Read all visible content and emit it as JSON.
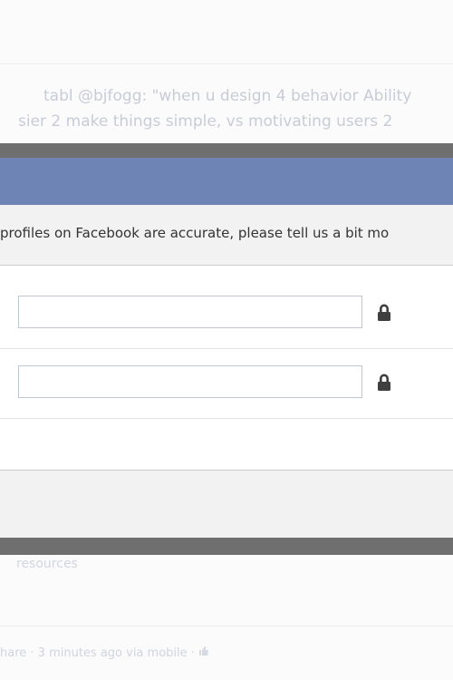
{
  "background": {
    "post_line1": "tabl @bjfogg: \"when u design 4 behavior Ability",
    "post_line2": "sier 2 make things simple, vs motivating users 2",
    "lower_text": "resources",
    "footer_text": "hare · 3 minutes ago via mobile · "
  },
  "dialog": {
    "title": "",
    "intro": "profiles on Facebook are accurate, please tell us a bit mo",
    "fields": [
      {
        "value": "",
        "privacy_icon": "lock-icon"
      },
      {
        "value": "",
        "privacy_icon": "lock-icon"
      }
    ]
  },
  "colors": {
    "header_blue": "#6d84b4",
    "header_border": "#3b5998",
    "overlay_gray": "#6f6f6f",
    "intro_bg": "#f2f2f2"
  }
}
